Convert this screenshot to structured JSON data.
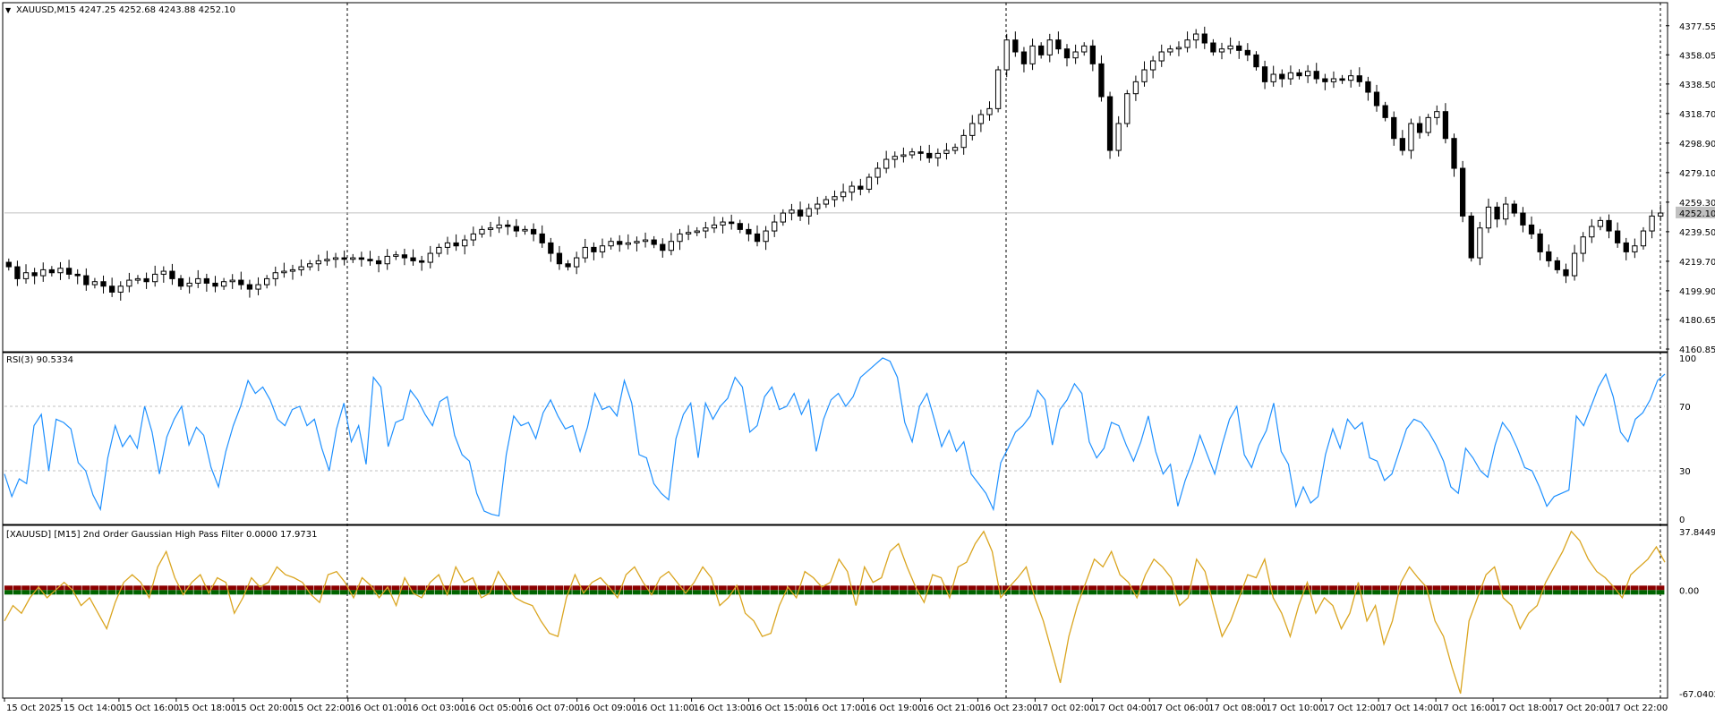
{
  "main_pane": {
    "header": "XAUUSD,M15  4247.25 4252.68 4243.88 4252.10",
    "price_labels": [
      "4377.55",
      "4358.05",
      "4338.50",
      "4318.70",
      "4298.90",
      "4279.10",
      "4259.30",
      "4239.50",
      "4219.70",
      "4199.90",
      "4180.65",
      "4160.85"
    ],
    "current_price": "4252.10"
  },
  "rsi_pane": {
    "header": "RSI(3) 90.5334",
    "levels": [
      "100",
      "70",
      "30",
      "0"
    ]
  },
  "filter_pane": {
    "header": "[XAUUSD] [M15] 2nd Order Gaussian High Pass Filter 0.0000 17.9731",
    "levels": [
      "37.8449",
      "0.00",
      "-67.0402"
    ]
  },
  "time_labels": [
    "15 Oct 2025",
    "15 Oct 14:00",
    "15 Oct 16:00",
    "15 Oct 18:00",
    "15 Oct 20:00",
    "15 Oct 22:00",
    "16 Oct 01:00",
    "16 Oct 03:00",
    "16 Oct 05:00",
    "16 Oct 07:00",
    "16 Oct 09:00",
    "16 Oct 11:00",
    "16 Oct 13:00",
    "16 Oct 15:00",
    "16 Oct 17:00",
    "16 Oct 19:00",
    "16 Oct 21:00",
    "16 Oct 23:00",
    "17 Oct 02:00",
    "17 Oct 04:00",
    "17 Oct 06:00",
    "17 Oct 08:00",
    "17 Oct 10:00",
    "17 Oct 12:00",
    "17 Oct 14:00",
    "17 Oct 16:00",
    "17 Oct 18:00",
    "17 Oct 20:00",
    "17 Oct 22:00"
  ],
  "colors": {
    "rsi_line": "#1e90ff",
    "filter_line": "#daa520",
    "histogram_positive": "#8b0000",
    "histogram_negative": "#006400",
    "price_line": "#c0c0c0"
  },
  "chart_data": {
    "type": "candlestick",
    "symbol": "XAUUSD",
    "timeframe": "M15",
    "price_closes": [
      4216,
      4208,
      4212,
      4210,
      4214,
      4212,
      4215,
      4211,
      4210,
      4204,
      4206,
      4203,
      4199,
      4203,
      4207,
      4208,
      4206,
      4211,
      4213,
      4208,
      4203,
      4205,
      4208,
      4205,
      4203,
      4206,
      4207,
      4204,
      4201,
      4204,
      4208,
      4212,
      4213,
      4214,
      4216,
      4218,
      4220,
      4221,
      4222,
      4221,
      4222,
      4221,
      4220,
      4218,
      4223,
      4224,
      4222,
      4220,
      4219,
      4225,
      4229,
      4232,
      4230,
      4234,
      4238,
      4241,
      4242,
      4244,
      4243,
      4240,
      4241,
      4238,
      4232,
      4225,
      4218,
      4216,
      4222,
      4229,
      4226,
      4230,
      4233,
      4231,
      4232,
      4233,
      4234,
      4231,
      4227,
      4233,
      4238,
      4239,
      4240,
      4242,
      4244,
      4246,
      4245,
      4241,
      4238,
      4233,
      4240,
      4246,
      4252,
      4254,
      4250,
      4255,
      4258,
      4261,
      4263,
      4266,
      4270,
      4268,
      4276,
      4282,
      4288,
      4290,
      4291,
      4293,
      4292,
      4289,
      4292,
      4294,
      4296,
      4304,
      4312,
      4318,
      4322,
      4348,
      4368,
      4360,
      4352,
      4364,
      4358,
      4368,
      4362,
      4356,
      4360,
      4364,
      4352,
      4330,
      4294,
      4312,
      4332,
      4340,
      4348,
      4354,
      4360,
      4362,
      4363,
      4368,
      4372,
      4366,
      4360,
      4362,
      4364,
      4361,
      4358,
      4350,
      4340,
      4345,
      4342,
      4346,
      4344,
      4347,
      4342,
      4340,
      4342,
      4341,
      4344,
      4340,
      4333,
      4324,
      4316,
      4302,
      4294,
      4312,
      4306,
      4316,
      4320,
      4302,
      4282,
      4250,
      4222,
      4242,
      4256,
      4248,
      4258,
      4252,
      4244,
      4238,
      4226,
      4220,
      4214,
      4210,
      4225,
      4236,
      4243,
      4247,
      4240,
      4232,
      4226,
      4230,
      4240,
      4250,
      4252
    ],
    "rsi_values": [
      28,
      14,
      25,
      22,
      58,
      65,
      30,
      62,
      60,
      56,
      35,
      30,
      15,
      6,
      38,
      58,
      45,
      52,
      44,
      70,
      54,
      28,
      51,
      62,
      70,
      46,
      57,
      52,
      32,
      20,
      42,
      58,
      70,
      86,
      78,
      82,
      74,
      62,
      58,
      68,
      70,
      58,
      62,
      44,
      30,
      56,
      72,
      48,
      58,
      34,
      88,
      82,
      45,
      60,
      62,
      80,
      74,
      65,
      58,
      73,
      76,
      52,
      40,
      36,
      16,
      5,
      3,
      2,
      40,
      64,
      58,
      60,
      50,
      66,
      74,
      64,
      56,
      58,
      42,
      57,
      78,
      68,
      70,
      64,
      86,
      72,
      40,
      38,
      22,
      16,
      12,
      50,
      65,
      72,
      38,
      72,
      62,
      70,
      75,
      88,
      82,
      54,
      58,
      76,
      82,
      68,
      70,
      78,
      65,
      74,
      42,
      62,
      74,
      78,
      70,
      76,
      88,
      92,
      96,
      100,
      98,
      88,
      60,
      48,
      70,
      78,
      62,
      45,
      55,
      42,
      48,
      28,
      22,
      16,
      6,
      35,
      44,
      54,
      58,
      64,
      80,
      74,
      46,
      68,
      74,
      84,
      78,
      48,
      38,
      44,
      60,
      58,
      46,
      36,
      48,
      64,
      42,
      28,
      34,
      8,
      24,
      36,
      52,
      40,
      28,
      46,
      62,
      70,
      40,
      32,
      46,
      55,
      72,
      42,
      34,
      8,
      20,
      10,
      14,
      40,
      56,
      44,
      62,
      56,
      60,
      38,
      36,
      24,
      28,
      42,
      56,
      62,
      60,
      54,
      46,
      36,
      20,
      16,
      44,
      38,
      30,
      26,
      46,
      60,
      54,
      44,
      32,
      30,
      20,
      8,
      14,
      16,
      18,
      64,
      58,
      70,
      82,
      90,
      76,
      54,
      48,
      62,
      66,
      74,
      86,
      90
    ],
    "filter_values": [
      -20,
      -10,
      -15,
      -5,
      2,
      -5,
      0,
      5,
      0,
      -10,
      -5,
      -15,
      -25,
      -8,
      5,
      10,
      5,
      -5,
      15,
      25,
      8,
      -3,
      5,
      10,
      -2,
      8,
      5,
      -15,
      -5,
      8,
      2,
      5,
      15,
      10,
      8,
      5,
      -3,
      -8,
      10,
      12,
      5,
      -5,
      8,
      3,
      -5,
      2,
      -10,
      8,
      -2,
      -5,
      5,
      10,
      -3,
      15,
      5,
      8,
      -5,
      -2,
      12,
      3,
      -5,
      -8,
      -10,
      -20,
      -28,
      -30,
      -5,
      10,
      -2,
      5,
      8,
      2,
      -5,
      10,
      15,
      5,
      -3,
      8,
      12,
      5,
      -2,
      5,
      15,
      8,
      -10,
      -5,
      3,
      -15,
      -20,
      -30,
      -28,
      -10,
      2,
      -5,
      12,
      8,
      2,
      5,
      20,
      12,
      -10,
      15,
      5,
      8,
      25,
      30,
      15,
      2,
      -8,
      10,
      8,
      -5,
      15,
      18,
      30,
      38,
      25,
      -5,
      2,
      8,
      15,
      -5,
      -20,
      -40,
      -60,
      -30,
      -10,
      5,
      20,
      15,
      25,
      10,
      5,
      -5,
      10,
      20,
      15,
      8,
      -10,
      -5,
      20,
      12,
      -10,
      -30,
      -20,
      -5,
      10,
      8,
      20,
      -5,
      -15,
      -30,
      -10,
      5,
      -15,
      -5,
      -10,
      -25,
      -15,
      5,
      -20,
      -10,
      -35,
      -20,
      5,
      15,
      8,
      2,
      -20,
      -30,
      -50,
      -67,
      -20,
      -5,
      10,
      15,
      -5,
      -10,
      -25,
      -15,
      -10,
      5,
      15,
      25,
      38,
      32,
      20,
      12,
      8,
      2,
      -5,
      10,
      15,
      20,
      28,
      18
    ]
  }
}
